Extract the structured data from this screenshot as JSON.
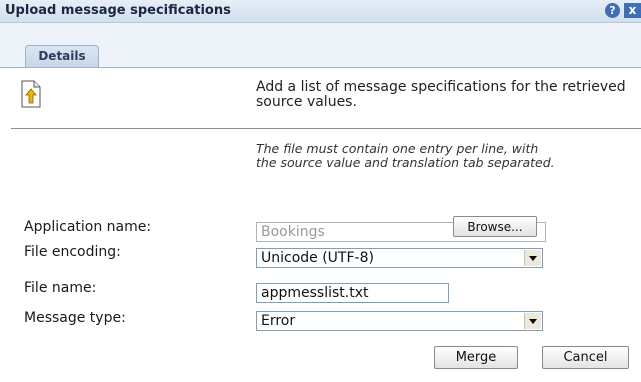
{
  "dialog": {
    "title": "Upload message specifications",
    "help_glyph": "?",
    "close_glyph": "x"
  },
  "tabs": [
    {
      "label": "Details"
    }
  ],
  "description": "Add a list of message specifications for the retrieved source values.",
  "note": "The file must contain one entry per line, with the source value and translation tab separated.",
  "form": {
    "application_name": {
      "label": "Application name:",
      "value": "Bookings",
      "disabled": true
    },
    "file_encoding": {
      "label": "File encoding:",
      "value": "Unicode (UTF-8)"
    },
    "file_name": {
      "label": "File name:",
      "value": "appmesslist.txt"
    },
    "message_type": {
      "label": "Message type:",
      "value": "Error"
    }
  },
  "buttons": {
    "browse": "Browse...",
    "merge": "Merge",
    "cancel": "Cancel"
  },
  "icons": {
    "upload": "upload-document-icon",
    "help": "help-icon",
    "close": "close-icon"
  },
  "colors": {
    "titlebar": "#d2dfee",
    "accent": "#3e6fb8",
    "upload_arrow": "#f0b400"
  }
}
